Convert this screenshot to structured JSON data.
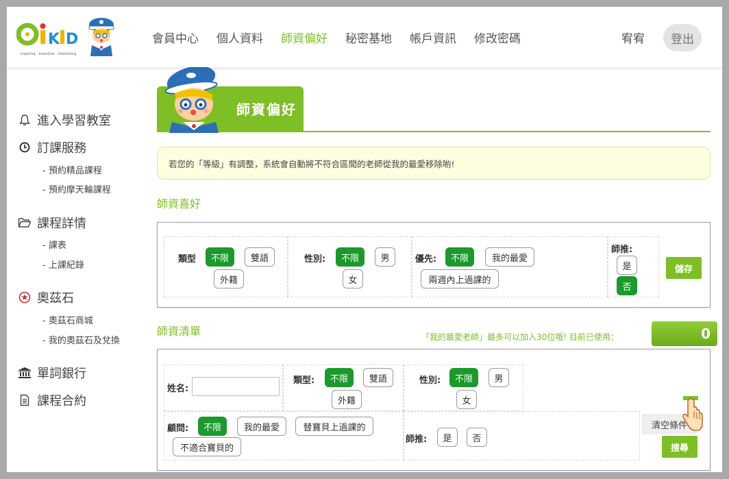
{
  "header": {
    "logo_text": "OiKID",
    "logo_tagline": "Inspiring · Inventive · Interesting",
    "nav": [
      "會員中心",
      "個人資料",
      "師資偏好",
      "秘密基地",
      "帳戶資訊",
      "修改密碼"
    ],
    "active_nav": "師資偏好",
    "user_name": "宥宥",
    "logout": "登出"
  },
  "sidebar": {
    "sections": [
      {
        "label": "進入學習教室",
        "icon": "bell-icon",
        "items": []
      },
      {
        "label": "訂課服務",
        "icon": "clock-icon",
        "items": [
          "- 預約精品課程",
          "- 預約摩天輪課程"
        ]
      },
      {
        "label": "課程詳情",
        "icon": "folder-open-icon",
        "items": [
          "- 課表",
          "- 上課紀錄"
        ]
      },
      {
        "label": "奧茲石",
        "icon": "gem-icon",
        "items": [
          "- 奧茲石商城",
          "- 我的奧茲石及兌換"
        ]
      },
      {
        "label": "單詞銀行",
        "icon": "bank-icon",
        "items": []
      },
      {
        "label": "課程合約",
        "icon": "document-icon",
        "items": []
      }
    ]
  },
  "main": {
    "page_title": "師資偏好",
    "notice": "若您的「等級」有調整，系統會自動將不符合區間的老師從我的最愛移除喲!",
    "preferences": {
      "section_title": "師資喜好",
      "type_label": "類型",
      "type_options": [
        "不限",
        "雙語",
        "外籍"
      ],
      "gender_label": "性別:",
      "gender_options": [
        "不限",
        "男",
        "女"
      ],
      "priority_label": "優先:",
      "priority_options": [
        "不限",
        "我的最愛",
        "兩週內上過課的"
      ],
      "recommend_label": "師推:",
      "recommend_options": [
        "是",
        "否"
      ],
      "save_button": "儲存"
    },
    "teacher_list": {
      "section_title": "師資清單",
      "favorite_limit_text": "「我的最愛老師」最多可以加入30位哦! 目前已使用：",
      "favorite_count": "0",
      "name_label": "姓名:",
      "name_value": "",
      "type_label": "類型:",
      "type_options": [
        "不限",
        "雙語",
        "外籍"
      ],
      "gender_label": "性別:",
      "gender_options": [
        "不限",
        "男",
        "女"
      ],
      "advisor_label": "顧問:",
      "advisor_options": [
        "不限",
        "我的最愛",
        "替寶貝上過課的",
        "不適合寶貝的"
      ],
      "recommend_label": "師推:",
      "recommend_options": [
        "是",
        "否"
      ],
      "clear_button": "清空條件",
      "search_button": "搜尋"
    }
  },
  "colors": {
    "accent_green": "#7dbf24",
    "selected_green": "#1a9a2a",
    "notice_bg": "#fdfde0",
    "frame_gray": "#a9a9a9"
  }
}
